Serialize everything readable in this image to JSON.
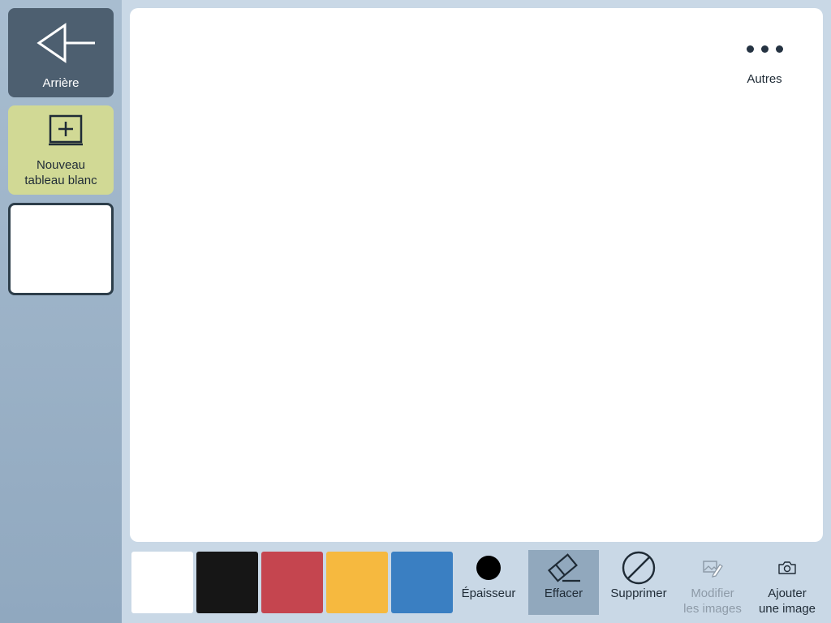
{
  "sidebar": {
    "back_label": "Arrière",
    "new_board_label_line1": "Nouveau",
    "new_board_label_line2": "tableau blanc"
  },
  "canvas": {
    "more_label": "Autres"
  },
  "toolbar": {
    "colors": [
      {
        "name": "white",
        "hex": "#ffffff"
      },
      {
        "name": "black",
        "hex": "#161616"
      },
      {
        "name": "red",
        "hex": "#c5454f"
      },
      {
        "name": "yellow",
        "hex": "#f6b93f"
      },
      {
        "name": "blue",
        "hex": "#3a7fc2"
      }
    ],
    "thickness_label": "Épaisseur",
    "erase_label": "Effacer",
    "delete_label": "Supprimer",
    "edit_images_line1": "Modifier",
    "edit_images_line2": "les images",
    "add_image_line1": "Ajouter",
    "add_image_line2": "une image"
  },
  "icons": {
    "back": "arrow-left-icon",
    "new_board": "add-board-icon",
    "more": "ellipsis-icon",
    "thickness": "dot-icon",
    "erase": "eraser-icon",
    "delete": "prohibited-icon",
    "edit_images": "edit-image-icon",
    "add_image": "camera-icon"
  }
}
